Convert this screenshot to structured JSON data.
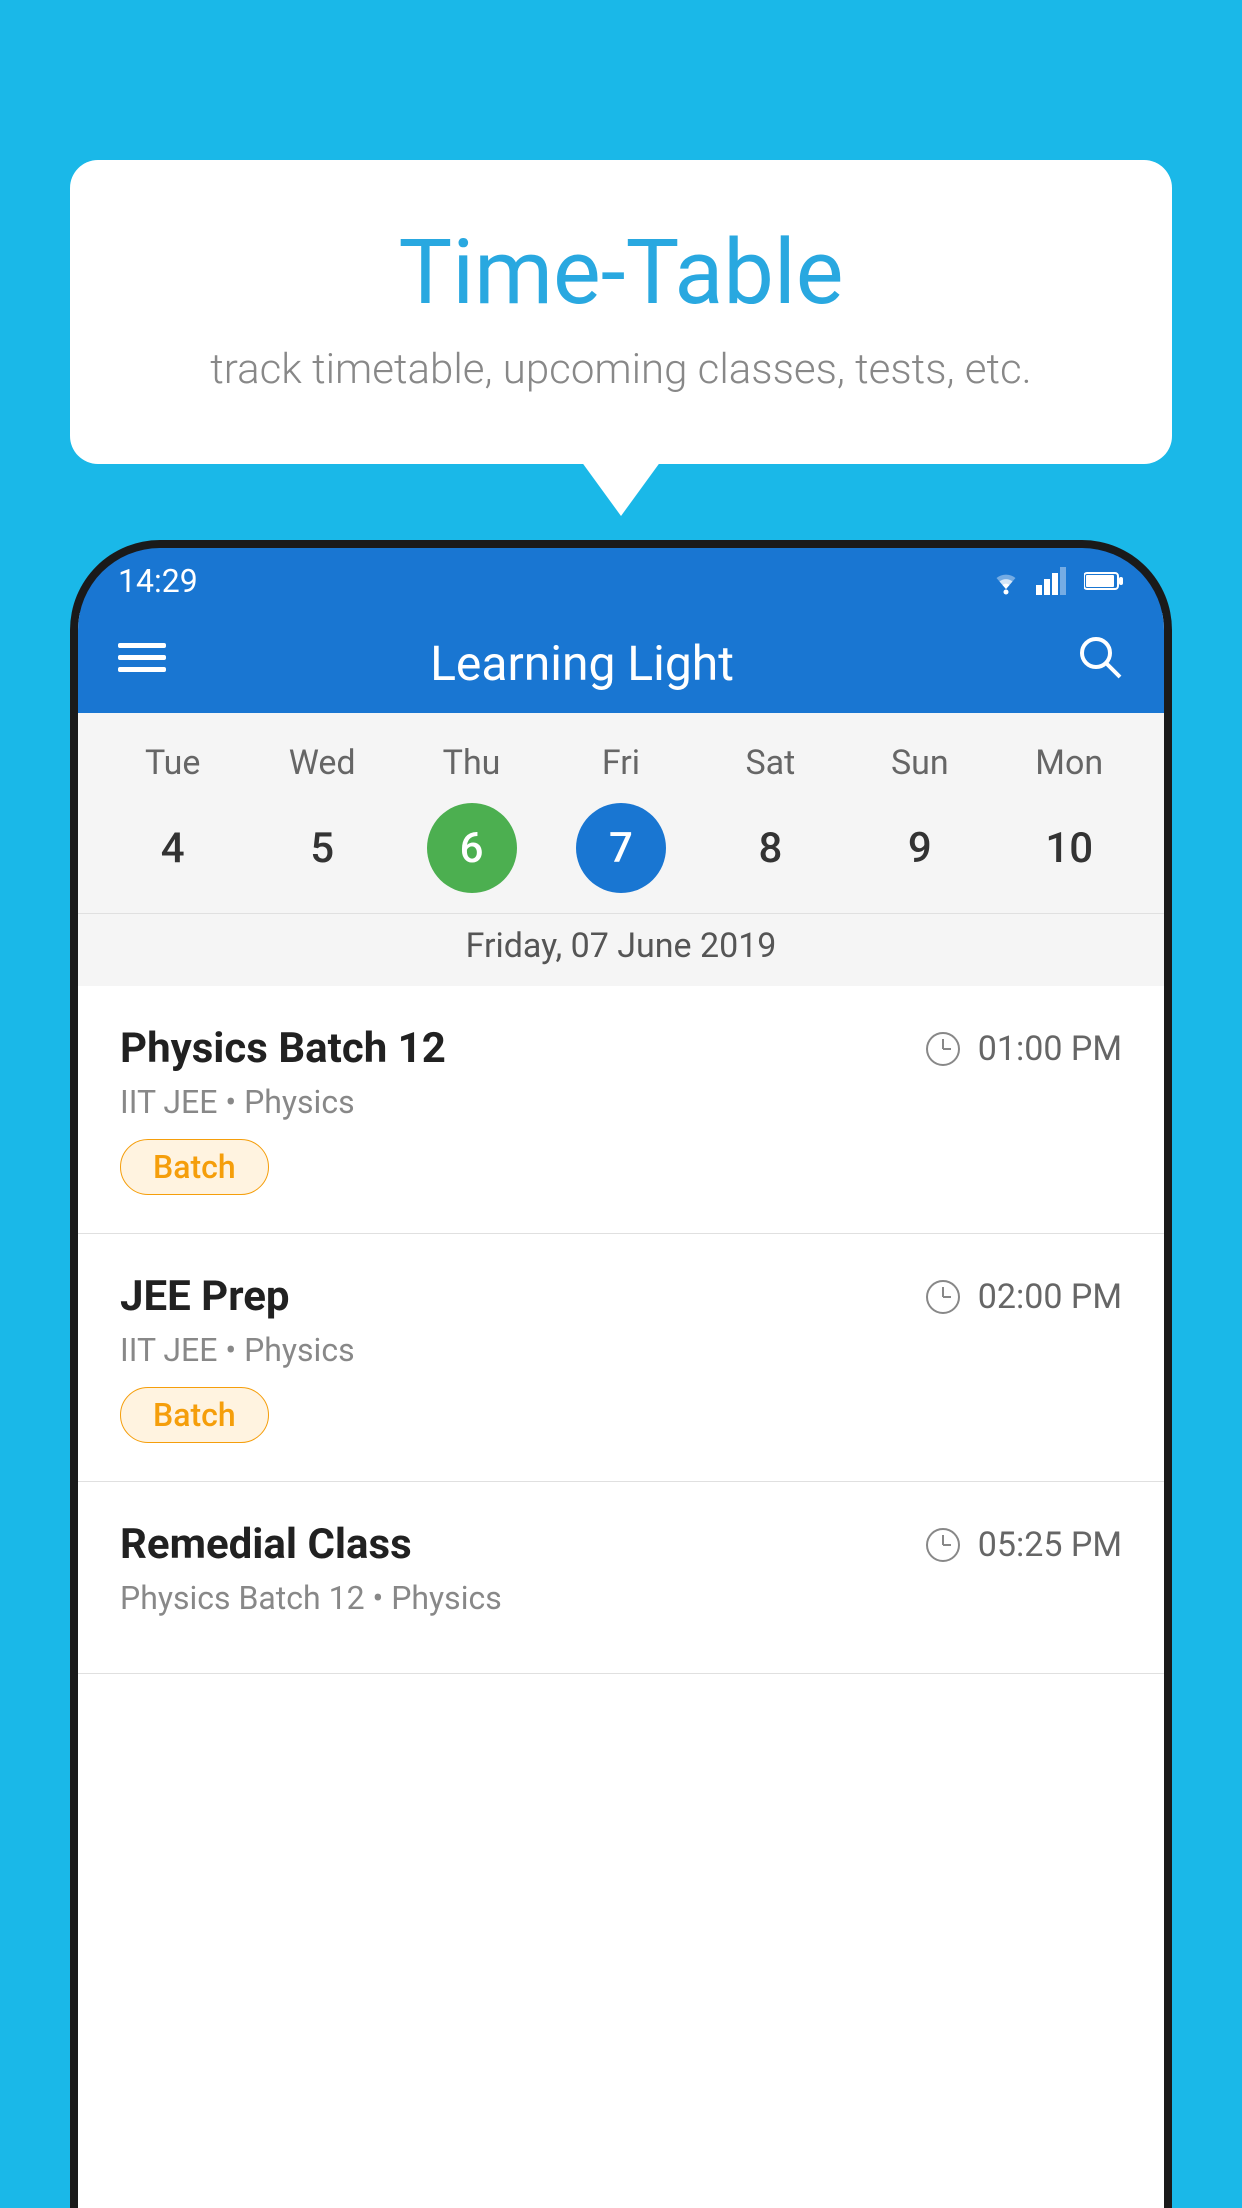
{
  "background_color": "#1ab8e8",
  "bubble": {
    "title": "Time-Table",
    "subtitle": "track timetable, upcoming classes, tests, etc."
  },
  "status_bar": {
    "time": "14:29"
  },
  "app_bar": {
    "title": "Learning Light"
  },
  "calendar": {
    "days": [
      "Tue",
      "Wed",
      "Thu",
      "Fri",
      "Sat",
      "Sun",
      "Mon"
    ],
    "dates": [
      4,
      5,
      6,
      7,
      8,
      9,
      10
    ],
    "today_index": 2,
    "selected_index": 3,
    "selected_label": "Friday, 07 June 2019"
  },
  "classes": [
    {
      "name": "Physics Batch 12",
      "time": "01:00 PM",
      "meta": "IIT JEE • Physics",
      "tag": "Batch"
    },
    {
      "name": "JEE Prep",
      "time": "02:00 PM",
      "meta": "IIT JEE • Physics",
      "tag": "Batch"
    },
    {
      "name": "Remedial Class",
      "time": "05:25 PM",
      "meta": "Physics Batch 12 • Physics",
      "tag": null
    }
  ]
}
